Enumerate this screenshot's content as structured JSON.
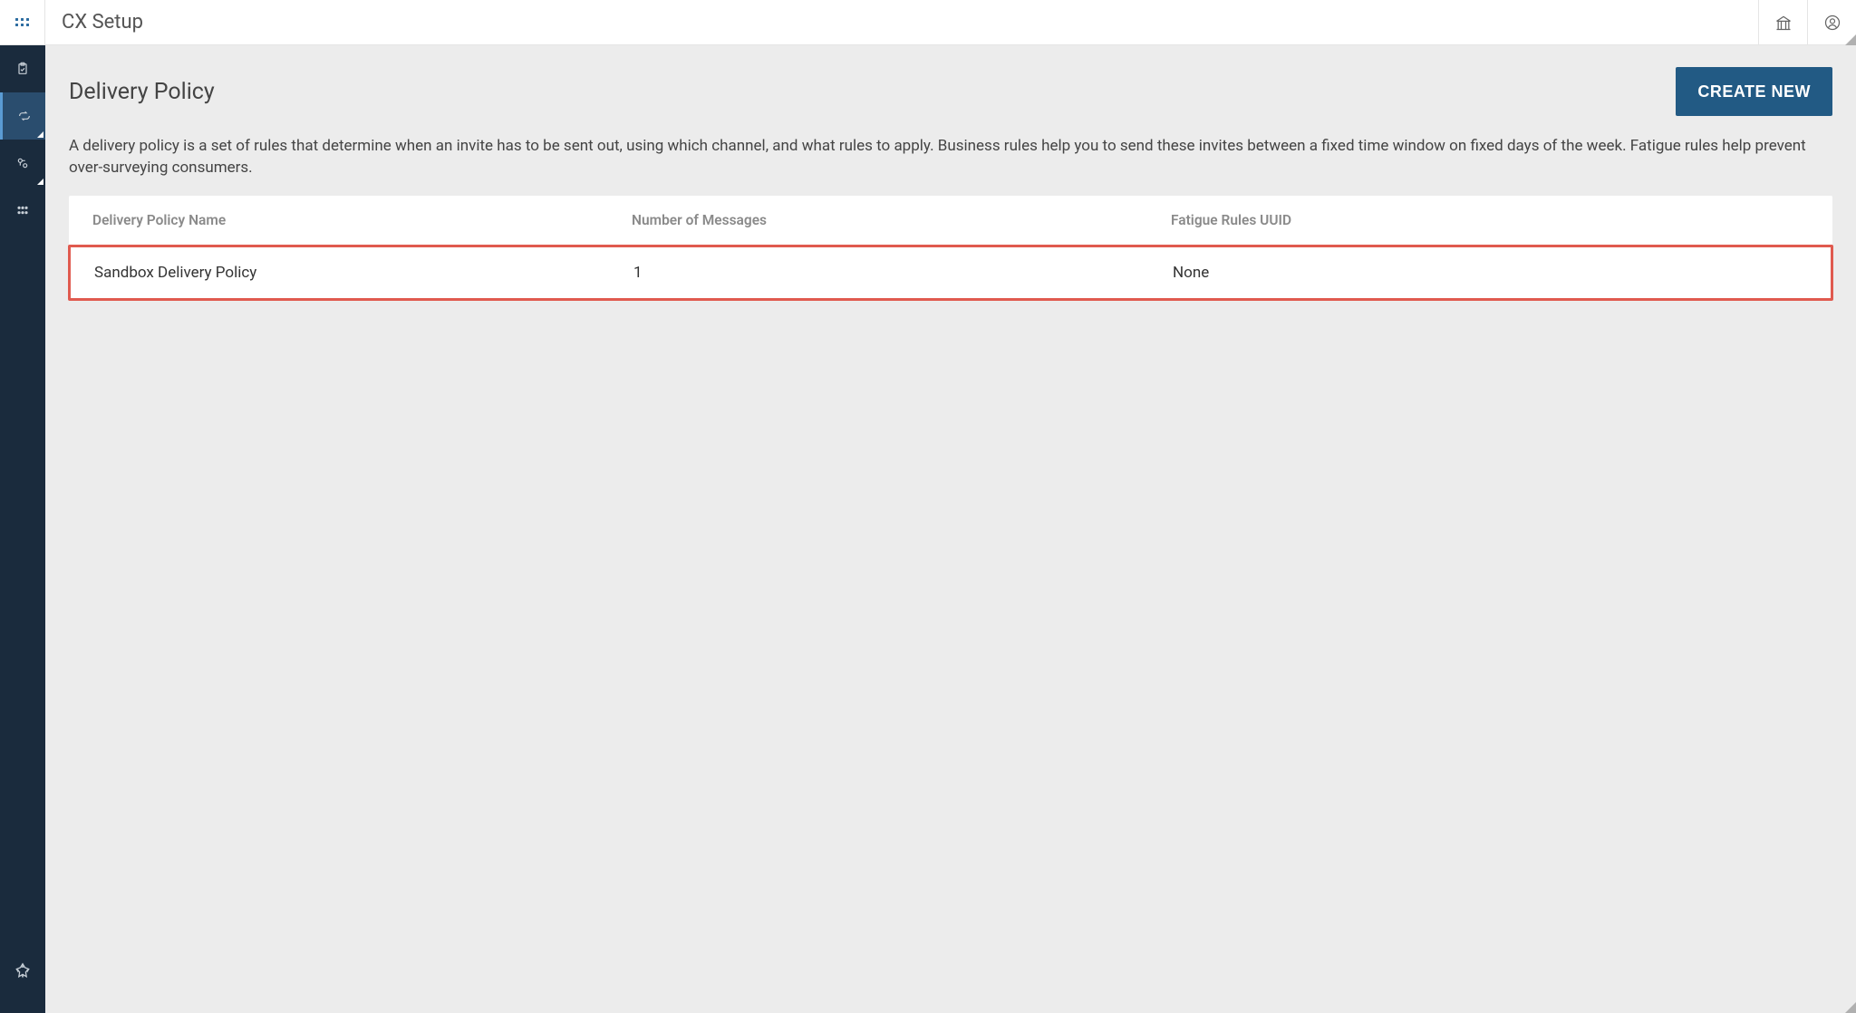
{
  "header": {
    "app_title": "CX Setup"
  },
  "page": {
    "title": "Delivery Policy",
    "create_button": "CREATE NEW",
    "description": "A delivery policy is a set of rules that determine when an invite has to be sent out, using which channel, and what rules to apply. Business rules help you to send these invites between a fixed time window on fixed days of the week. Fatigue rules help prevent over-surveying consumers."
  },
  "table": {
    "columns": {
      "name": "Delivery Policy Name",
      "messages": "Number of Messages",
      "uuid": "Fatigue Rules UUID"
    },
    "rows": [
      {
        "name": "Sandbox Delivery Policy",
        "messages": "1",
        "uuid": "None"
      }
    ]
  }
}
